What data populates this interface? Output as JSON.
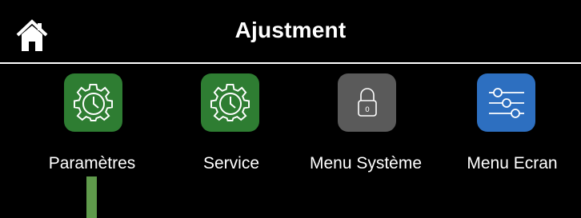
{
  "header": {
    "title": "Ajustment",
    "home_icon": "home-icon"
  },
  "menu": {
    "items": [
      {
        "label": "Paramètres",
        "icon": "settings-clock-icon",
        "color": "#2e7d32",
        "selected": true
      },
      {
        "label": "Service",
        "icon": "settings-clock-icon",
        "color": "#2e7d32",
        "selected": false
      },
      {
        "label": "Menu Système",
        "icon": "lock-icon",
        "color": "#5a5a5a",
        "selected": false
      },
      {
        "label": "Menu Ecran",
        "icon": "sliders-icon",
        "color": "#2d6fc0",
        "selected": false
      }
    ]
  },
  "colors": {
    "background": "#000000",
    "text": "#ffffff",
    "selection_indicator": "#5f9a4b"
  }
}
